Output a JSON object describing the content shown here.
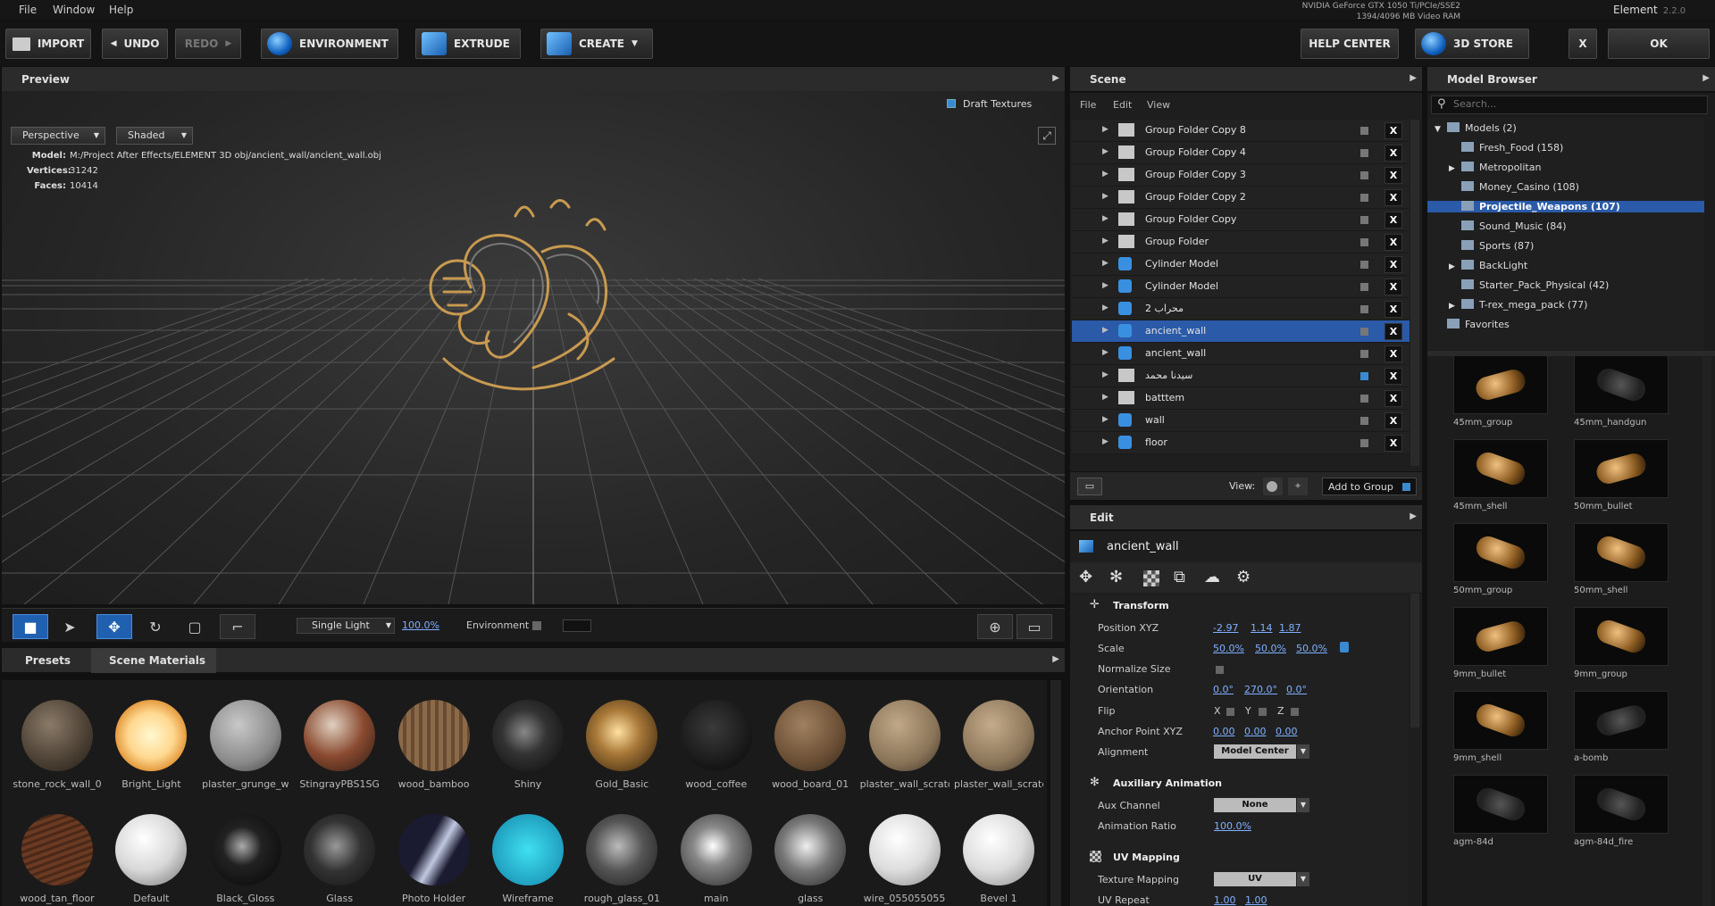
{
  "menu": [
    "File",
    "Window",
    "Help"
  ],
  "gpu": {
    "line1": "NVIDIA GeForce GTX 1050 Ti/PCIe/SSE2",
    "line2": "1394/4096 MB Video RAM"
  },
  "app": {
    "name": "Element",
    "version": "2.2.0"
  },
  "toolbar": {
    "import": "IMPORT",
    "undo": "UNDO",
    "redo": "REDO",
    "environment": "ENVIRONMENT",
    "extrude": "EXTRUDE",
    "create": "CREATE",
    "help_center": "HELP CENTER",
    "store": "3D STORE",
    "close": "X",
    "ok": "OK"
  },
  "preview": {
    "title": "Preview",
    "draft_textures": "Draft Textures",
    "view_mode": "Perspective",
    "shade_mode": "Shaded",
    "model_label": "Model:",
    "model_path": "M:/Project After Effects/ELEMENT 3D obj/ancient_wall/ancient_wall.obj",
    "vertices_label": "Vertices:",
    "vertices": "31242",
    "faces_label": "Faces:",
    "faces": "10414",
    "lighting": "Single Light",
    "light_pct": "100.0%",
    "environment": "Environment"
  },
  "materials": {
    "tabs": [
      "Presets",
      "Scene Materials"
    ],
    "items": [
      {
        "name": "stone_rock_wall_0",
        "bg": "radial-gradient(circle at 40% 35%,#8a7a68,#4a3f33 60%,#221c16)"
      },
      {
        "name": "Bright_Light",
        "bg": "radial-gradient(circle at 50% 50%,#fff8d0,#ffd890 45%,#e09030 75%,#603010)"
      },
      {
        "name": "plaster_grunge_w",
        "bg": "radial-gradient(circle at 40% 35%,#c8c8c8,#8a8a8a 60%,#3a3a3a)"
      },
      {
        "name": "StingrayPBS1SG",
        "bg": "radial-gradient(circle at 40% 35%,#e0d0c0,#8a4a30 50%,#2a1a12)"
      },
      {
        "name": "wood_bamboo",
        "bg": "repeating-linear-gradient(90deg,#8a6a48 0 5px,#6a4a30 5px 9px)"
      },
      {
        "name": "Shiny",
        "bg": "radial-gradient(circle at 45% 45%,#888,#333 40%,#0a0a0a)"
      },
      {
        "name": "Gold_Basic",
        "bg": "radial-gradient(circle at 45% 45%,#ffe0a0,#a87838 40%,#2a1a08)"
      },
      {
        "name": "wood_coffee",
        "bg": "radial-gradient(circle at 45% 40%,#3a3a3a,#151515 70%)"
      },
      {
        "name": "wood_board_01",
        "bg": "radial-gradient(circle at 40% 35%,#a08060,#6a4e34 60%,#30241a)"
      },
      {
        "name": "plaster_wall_scratc",
        "bg": "radial-gradient(circle at 40% 35%,#c0a888,#8a7458 60%,#3a3024)"
      },
      {
        "name": "plaster_wall_scratc",
        "bg": "radial-gradient(circle at 40% 35%,#c4ac8a,#8c765a 60%,#3c3226)"
      },
      {
        "name": "wood_tan_floor",
        "bg": "repeating-linear-gradient(160deg,#6a3a22 0 4px,#4a2818 4px 7px)"
      },
      {
        "name": "Default",
        "bg": "radial-gradient(circle at 40% 35%,#fff,#d8d8d8 50%,#707070)"
      },
      {
        "name": "Black_Gloss",
        "bg": "radial-gradient(circle at 45% 45%,#aaa,#222 35%,#050505)"
      },
      {
        "name": "Glass",
        "bg": "radial-gradient(circle at 45% 45%,#999,#333 45%,#111)"
      },
      {
        "name": "Photo Holder",
        "bg": "linear-gradient(120deg,#1a1a30 40%,#c0c8e0 55%,#1a1a30 70%)"
      },
      {
        "name": "Wireframe",
        "bg": "radial-gradient(circle,#40e0f0 0%,#20a0c0 70%,#0a3040)"
      },
      {
        "name": "rough_glass_01",
        "bg": "radial-gradient(circle at 45% 45%,#bbb,#555 45%,#1a1a1a)"
      },
      {
        "name": "main",
        "bg": "radial-gradient(circle at 45% 45%,#fff,#888 35%,#222)"
      },
      {
        "name": "glass",
        "bg": "radial-gradient(circle at 45% 45%,#eee,#777 45%,#222)"
      },
      {
        "name": "wire_055055055",
        "bg": "radial-gradient(circle at 40% 35%,#fff,#ddd 50%,#888)"
      },
      {
        "name": "Bevel 1",
        "bg": "radial-gradient(circle at 40% 35%,#fff,#ddd 50%,#888)"
      }
    ]
  },
  "scene": {
    "title": "Scene",
    "menu": [
      "File",
      "Edit",
      "View"
    ],
    "rows": [
      {
        "name": "Group Folder Copy 8",
        "type": "folder",
        "sel": false
      },
      {
        "name": "Group Folder Copy 4",
        "type": "folder",
        "sel": false
      },
      {
        "name": "Group Folder Copy 3",
        "type": "folder",
        "sel": false
      },
      {
        "name": "Group Folder Copy 2",
        "type": "folder",
        "sel": false
      },
      {
        "name": "Group Folder Copy",
        "type": "folder",
        "sel": false
      },
      {
        "name": "Group Folder",
        "type": "folder",
        "sel": false
      },
      {
        "name": "Cylinder Model",
        "type": "cyl",
        "sel": false
      },
      {
        "name": "Cylinder Model",
        "type": "cyl",
        "sel": false
      },
      {
        "name": "محراب 2",
        "type": "extrude",
        "sel": false
      },
      {
        "name": "ancient_wall",
        "type": "cube",
        "sel": true
      },
      {
        "name": "ancient_wall",
        "type": "cube",
        "sel": false
      },
      {
        "name": "سيدنا محمد",
        "type": "folder",
        "sel": false
      },
      {
        "name": "batttem",
        "type": "folder",
        "sel": false
      },
      {
        "name": "wall",
        "type": "plane",
        "sel": false
      },
      {
        "name": "floor",
        "type": "plane",
        "sel": false
      }
    ],
    "view_label": "View:",
    "add_to_group": "Add to Group"
  },
  "edit": {
    "title": "Edit",
    "object": "ancient_wall",
    "transform": "Transform",
    "position_label": "Position XYZ",
    "position": [
      "-2.97",
      "1.14",
      "1.87"
    ],
    "scale_label": "Scale",
    "scale": [
      "50.0%",
      "50.0%",
      "50.0%"
    ],
    "normalize_label": "Normalize Size",
    "orientation_label": "Orientation",
    "orientation": [
      "0.0°",
      "270.0°",
      "0.0°"
    ],
    "flip_label": "Flip",
    "flip_axes": [
      "X",
      "Y",
      "Z"
    ],
    "anchor_label": "Anchor Point XYZ",
    "anchor": [
      "0.00",
      "0.00",
      "0.00"
    ],
    "alignment_label": "Alignment",
    "alignment": "Model Center",
    "aux_title": "Auxiliary Animation",
    "aux_channel_label": "Aux Channel",
    "aux_channel": "None",
    "anim_ratio_label": "Animation Ratio",
    "anim_ratio": "100.0%",
    "uv_title": "UV Mapping",
    "tex_map_label": "Texture Mapping",
    "tex_map": "UV",
    "uv_repeat_label": "UV Repeat",
    "uv_repeat": [
      "1.00",
      "1.00"
    ]
  },
  "browser": {
    "title": "Model Browser",
    "search_placeholder": "Search...",
    "tree": [
      {
        "label": "Models (2)",
        "indent": 0,
        "exp": "▼",
        "sel": false
      },
      {
        "label": "Fresh_Food (158)",
        "indent": 1,
        "exp": "",
        "sel": false
      },
      {
        "label": "Metropolitan",
        "indent": 1,
        "exp": "▶",
        "sel": false
      },
      {
        "label": "Money_Casino (108)",
        "indent": 1,
        "exp": "",
        "sel": false
      },
      {
        "label": "Projectile_Weapons (107)",
        "indent": 1,
        "exp": "",
        "sel": true
      },
      {
        "label": "Sound_Music (84)",
        "indent": 1,
        "exp": "",
        "sel": false
      },
      {
        "label": "Sports (87)",
        "indent": 1,
        "exp": "",
        "sel": false
      },
      {
        "label": "BackLight",
        "indent": 1,
        "exp": "▶",
        "sel": false
      },
      {
        "label": "Starter_Pack_Physical (42)",
        "indent": 1,
        "exp": "",
        "sel": false
      },
      {
        "label": "T-rex_mega_pack (77)",
        "indent": 1,
        "exp": "▶",
        "sel": false
      },
      {
        "label": "Favorites",
        "indent": 0,
        "exp": "",
        "sel": false
      }
    ],
    "thumbs": [
      "45mm_group",
      "45mm_handgun",
      "45mm_shell",
      "50mm_bullet",
      "50mm_group",
      "50mm_shell",
      "9mm_bullet",
      "9mm_group",
      "9mm_shell",
      "a-bomb",
      "agm-84d",
      "agm-84d_fire"
    ]
  }
}
